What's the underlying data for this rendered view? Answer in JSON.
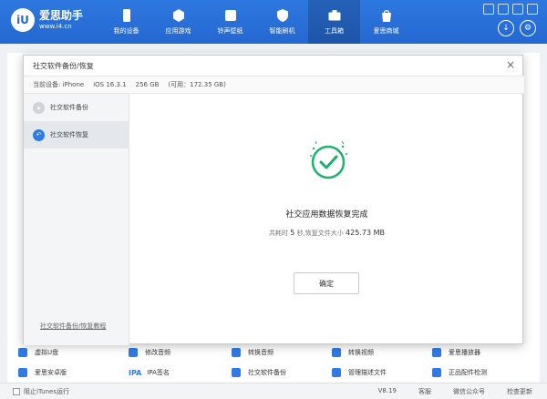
{
  "app": {
    "logo_badge": "iU",
    "name": "爱思助手",
    "url": "www.i4.cn"
  },
  "nav": [
    {
      "label": "我的设备",
      "icon": "phone-icon"
    },
    {
      "label": "应用游戏",
      "icon": "cube-icon"
    },
    {
      "label": "铃声壁纸",
      "icon": "bell-icon"
    },
    {
      "label": "智能刷机",
      "icon": "shield-icon"
    },
    {
      "label": "工具箱",
      "icon": "toolbox-icon",
      "active": true
    },
    {
      "label": "爱思商城",
      "icon": "bag-icon"
    }
  ],
  "header_buttons": {
    "download": "↓",
    "settings": "⚙"
  },
  "modal": {
    "title": "社交软件备份/恢复",
    "close": "×",
    "device": {
      "label": "当前设备: iPhone",
      "ios": "iOS 16.3.1",
      "capacity": "256 GB",
      "available": "(可用：172.35 GB)"
    },
    "sidebar": [
      {
        "label": "社交软件备份",
        "icon": "backup-icon"
      },
      {
        "label": "社交软件恢复",
        "icon": "restore-icon",
        "active": true
      }
    ],
    "help_link": "社交软件备份/恢复教程",
    "result": {
      "title": "社交应用数据恢复完成",
      "time_label": "共耗时",
      "time_value": "5",
      "time_unit": "秒",
      "size_label": ",恢复文件大小",
      "size_value": "425.73 MB"
    },
    "ok_button": "确定"
  },
  "tools": [
    {
      "label": "虚拟U盘",
      "icon": "usb-icon"
    },
    {
      "label": "修改音频",
      "icon": "audio-icon"
    },
    {
      "label": "转换音频",
      "icon": "convert-audio-icon"
    },
    {
      "label": "转换视频",
      "icon": "convert-video-icon"
    },
    {
      "label": "爱思播放器",
      "icon": "player-icon"
    },
    {
      "label": "爱思安卓版",
      "icon": "android-icon"
    },
    {
      "label": "IPA签名",
      "icon": "ipa-icon",
      "prefix": "IPA"
    },
    {
      "label": "社交软件备份",
      "icon": "social-backup-icon"
    },
    {
      "label": "管理描述文件",
      "icon": "profile-icon"
    },
    {
      "label": "正品配件检测",
      "icon": "earphone-icon"
    }
  ],
  "status": {
    "itunes": "阻止iTunes运行",
    "version": "V8.19",
    "service": "客服",
    "wechat": "微信公众号",
    "update": "检查更新"
  },
  "colors": {
    "brand": "#2468d0",
    "accent": "#2f7ae5",
    "success": "#19b36b"
  }
}
